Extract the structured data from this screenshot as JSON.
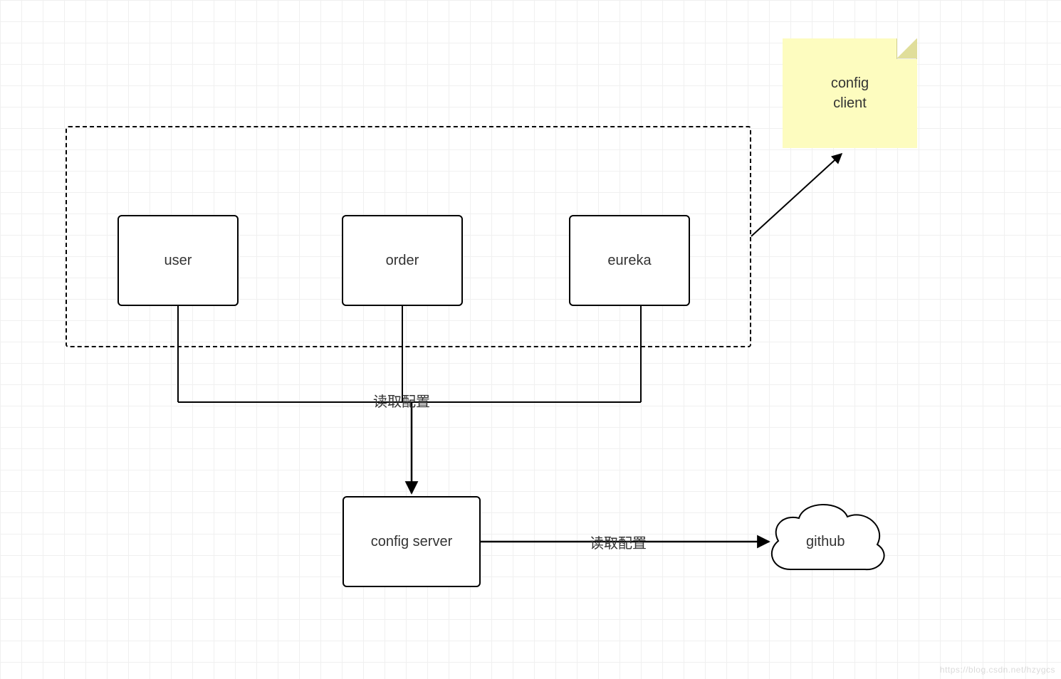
{
  "nodes": {
    "user": {
      "label": "user"
    },
    "order": {
      "label": "order"
    },
    "eureka": {
      "label": "eureka"
    },
    "config_server": {
      "label": "config server"
    },
    "github": {
      "label": "github"
    },
    "config_client": {
      "label": "config\nclient"
    }
  },
  "edges": {
    "clients_to_server": {
      "label": "读取配置"
    },
    "server_to_github": {
      "label": "读取配置"
    }
  },
  "watermark": "https://blog.csdn.net/hzygcs"
}
